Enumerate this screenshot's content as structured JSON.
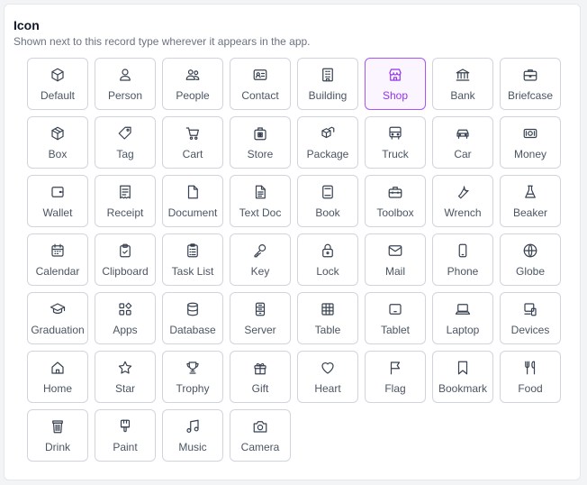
{
  "section": {
    "title": "Icon",
    "subtitle": "Shown next to this record type wherever it appears in the app."
  },
  "accent_color": "#9333ea",
  "selected": "Shop",
  "icons": [
    {
      "label": "Default",
      "icon": "cube-icon"
    },
    {
      "label": "Person",
      "icon": "person-icon"
    },
    {
      "label": "People",
      "icon": "people-icon"
    },
    {
      "label": "Contact",
      "icon": "contact-card-icon"
    },
    {
      "label": "Building",
      "icon": "building-icon"
    },
    {
      "label": "Shop",
      "icon": "shop-icon"
    },
    {
      "label": "Bank",
      "icon": "bank-icon"
    },
    {
      "label": "Briefcase",
      "icon": "briefcase-icon"
    },
    {
      "label": "Box",
      "icon": "box-icon"
    },
    {
      "label": "Tag",
      "icon": "tag-icon"
    },
    {
      "label": "Cart",
      "icon": "cart-icon"
    },
    {
      "label": "Store",
      "icon": "store-icon"
    },
    {
      "label": "Package",
      "icon": "package-icon"
    },
    {
      "label": "Truck",
      "icon": "truck-icon"
    },
    {
      "label": "Car",
      "icon": "car-icon"
    },
    {
      "label": "Money",
      "icon": "money-icon"
    },
    {
      "label": "Wallet",
      "icon": "wallet-icon"
    },
    {
      "label": "Receipt",
      "icon": "receipt-icon"
    },
    {
      "label": "Document",
      "icon": "document-icon"
    },
    {
      "label": "Text Doc",
      "icon": "text-doc-icon"
    },
    {
      "label": "Book",
      "icon": "book-icon"
    },
    {
      "label": "Toolbox",
      "icon": "toolbox-icon"
    },
    {
      "label": "Wrench",
      "icon": "wrench-icon"
    },
    {
      "label": "Beaker",
      "icon": "beaker-icon"
    },
    {
      "label": "Calendar",
      "icon": "calendar-icon"
    },
    {
      "label": "Clipboard",
      "icon": "clipboard-icon"
    },
    {
      "label": "Task List",
      "icon": "task-list-icon"
    },
    {
      "label": "Key",
      "icon": "key-icon"
    },
    {
      "label": "Lock",
      "icon": "lock-icon"
    },
    {
      "label": "Mail",
      "icon": "mail-icon"
    },
    {
      "label": "Phone",
      "icon": "phone-icon"
    },
    {
      "label": "Globe",
      "icon": "globe-icon"
    },
    {
      "label": "Graduation",
      "icon": "graduation-cap-icon"
    },
    {
      "label": "Apps",
      "icon": "apps-icon"
    },
    {
      "label": "Database",
      "icon": "database-icon"
    },
    {
      "label": "Server",
      "icon": "server-icon"
    },
    {
      "label": "Table",
      "icon": "table-icon"
    },
    {
      "label": "Tablet",
      "icon": "tablet-icon"
    },
    {
      "label": "Laptop",
      "icon": "laptop-icon"
    },
    {
      "label": "Devices",
      "icon": "devices-icon"
    },
    {
      "label": "Home",
      "icon": "home-icon"
    },
    {
      "label": "Star",
      "icon": "star-icon"
    },
    {
      "label": "Trophy",
      "icon": "trophy-icon"
    },
    {
      "label": "Gift",
      "icon": "gift-icon"
    },
    {
      "label": "Heart",
      "icon": "heart-icon"
    },
    {
      "label": "Flag",
      "icon": "flag-icon"
    },
    {
      "label": "Bookmark",
      "icon": "bookmark-icon"
    },
    {
      "label": "Food",
      "icon": "food-icon"
    },
    {
      "label": "Drink",
      "icon": "drink-icon"
    },
    {
      "label": "Paint",
      "icon": "paint-icon"
    },
    {
      "label": "Music",
      "icon": "music-icon"
    },
    {
      "label": "Camera",
      "icon": "camera-icon"
    }
  ]
}
